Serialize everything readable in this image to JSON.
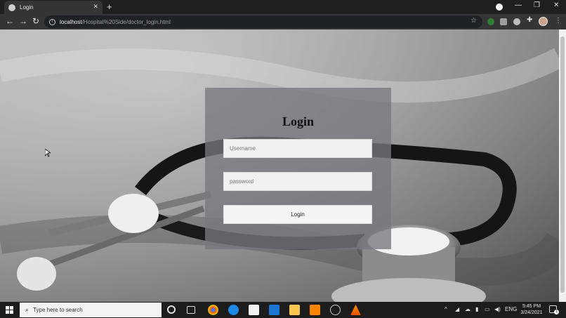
{
  "browser": {
    "tab_title": "Login",
    "tab_close": "✕",
    "new_tab": "+",
    "url_host": "localhost",
    "url_path": "/Hospital%20Side/doctor_login.html",
    "window_controls": [
      "—",
      "❐",
      "✕"
    ]
  },
  "page": {
    "title": "Login",
    "username_placeholder": "Username",
    "password_placeholder": "password",
    "login_button": "Login"
  },
  "taskbar": {
    "search_placeholder": "Type here to search",
    "language": "ENG",
    "time": "5:45 PM",
    "date": "3/24/2021",
    "notification_count": "1"
  },
  "colors": {
    "card_bg": "#78787d",
    "chrome_dark": "#1f1f1f",
    "toolbar": "#353535"
  }
}
